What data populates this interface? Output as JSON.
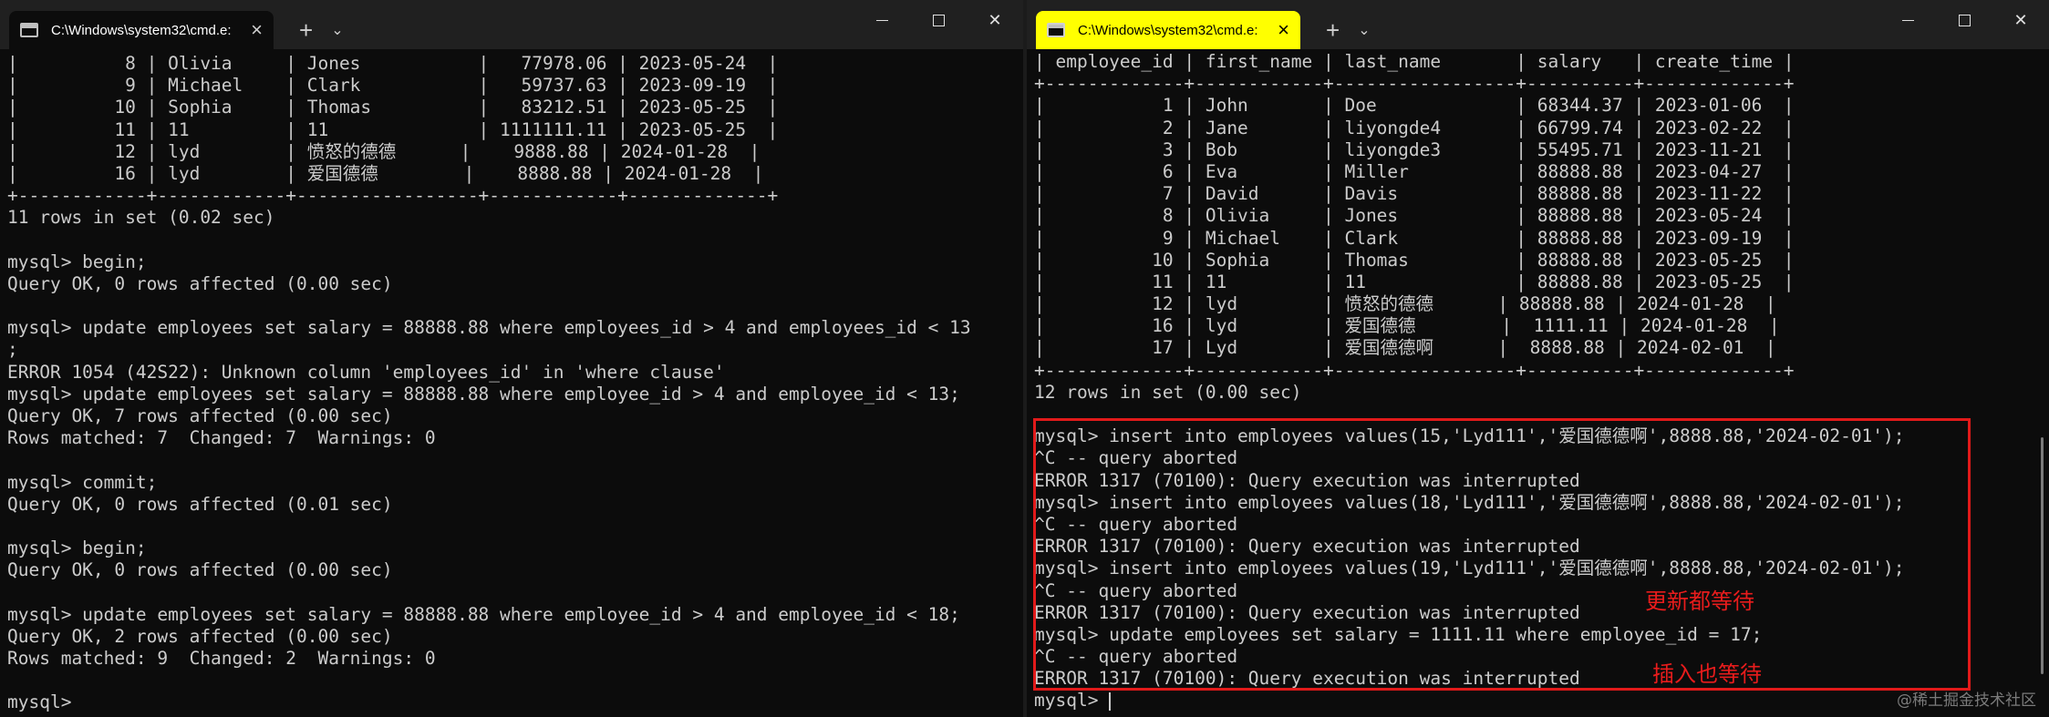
{
  "left_window": {
    "tab_title": "C:\\Windows\\system32\\cmd.e:",
    "tab_close": "×",
    "new_tab": "+",
    "tab_menu": "⌄",
    "lines": [
      "|          8 | Olivia     | Jones           |   77978.06 | 2023-05-24  |",
      "|          9 | Michael    | Clark           |   59737.63 | 2023-09-19  |",
      "|         10 | Sophia     | Thomas          |   83212.51 | 2023-05-25  |",
      "|         11 | 11         | 11              | 1111111.11 | 2023-05-25  |",
      "|         12 | lyd        | 愤怒的德德      |    9888.88 | 2024-01-28  |",
      "|         16 | lyd        | 爱国德德        |    8888.88 | 2024-01-28  |",
      "+------------+------------+-----------------+------------+-------------+",
      "11 rows in set (0.02 sec)",
      "",
      "mysql> begin;",
      "Query OK, 0 rows affected (0.00 sec)",
      "",
      "mysql> update employees set salary = 88888.88 where employees_id > 4 and employees_id < 13",
      ";",
      "ERROR 1054 (42S22): Unknown column 'employees_id' in 'where clause'",
      "mysql> update employees set salary = 88888.88 where employee_id > 4 and employee_id < 13;",
      "Query OK, 7 rows affected (0.00 sec)",
      "Rows matched: 7  Changed: 7  Warnings: 0",
      "",
      "mysql> commit;",
      "Query OK, 0 rows affected (0.01 sec)",
      "",
      "mysql> begin;",
      "Query OK, 0 rows affected (0.00 sec)",
      "",
      "mysql> update employees set salary = 88888.88 where employee_id > 4 and employee_id < 18;",
      "Query OK, 2 rows affected (0.00 sec)",
      "Rows matched: 9  Changed: 2  Warnings: 0",
      "",
      "mysql>"
    ]
  },
  "right_window": {
    "tab_title": "C:\\Windows\\system32\\cmd.e:",
    "tab_close": "×",
    "new_tab": "+",
    "tab_menu": "⌄",
    "lines": [
      "| employee_id | first_name | last_name       | salary   | create_time |",
      "+-------------+------------+-----------------+----------+-------------+",
      "|           1 | John       | Doe             | 68344.37 | 2023-01-06  |",
      "|           2 | Jane       | liyongde4       | 66799.74 | 2023-02-22  |",
      "|           3 | Bob        | liyongde3       | 55495.71 | 2023-11-21  |",
      "|           6 | Eva        | Miller          | 88888.88 | 2023-04-27  |",
      "|           7 | David      | Davis           | 88888.88 | 2023-11-22  |",
      "|           8 | Olivia     | Jones           | 88888.88 | 2023-05-24  |",
      "|           9 | Michael    | Clark           | 88888.88 | 2023-09-19  |",
      "|          10 | Sophia     | Thomas          | 88888.88 | 2023-05-25  |",
      "|          11 | 11         | 11              | 88888.88 | 2023-05-25  |",
      "|          12 | lyd        | 愤怒的德德      | 88888.88 | 2024-01-28  |",
      "|          16 | lyd        | 爱国德德        |  1111.11 | 2024-01-28  |",
      "|          17 | Lyd        | 爱国德德啊      |  8888.88 | 2024-02-01  |",
      "+-------------+------------+-----------------+----------+-------------+",
      "12 rows in set (0.00 sec)",
      "",
      "mysql> insert into employees values(15,'Lyd111','爱国德德啊',8888.88,'2024-02-01');",
      "^C -- query aborted",
      "ERROR 1317 (70100): Query execution was interrupted",
      "mysql> insert into employees values(18,'Lyd111','爱国德德啊',8888.88,'2024-02-01');",
      "^C -- query aborted",
      "ERROR 1317 (70100): Query execution was interrupted",
      "mysql> insert into employees values(19,'Lyd111','爱国德德啊',8888.88,'2024-02-01');",
      "^C -- query aborted",
      "ERROR 1317 (70100): Query execution was interrupted",
      "mysql> update employees set salary = 1111.11 where employee_id = 17;",
      "^C -- query aborted",
      "ERROR 1317 (70100): Query execution was interrupted",
      "mysql> "
    ]
  },
  "annotations": {
    "update_wait": "更新都等待",
    "insert_wait": "插入也等待",
    "highlight_color": "#e11a1a"
  },
  "watermark": "@稀土掘金技术社区",
  "colors": {
    "console_bg": "#0c0c0c",
    "console_text": "#cccccc",
    "titlebar_bg": "#202020",
    "active_tab_bg": "#ffff00"
  }
}
